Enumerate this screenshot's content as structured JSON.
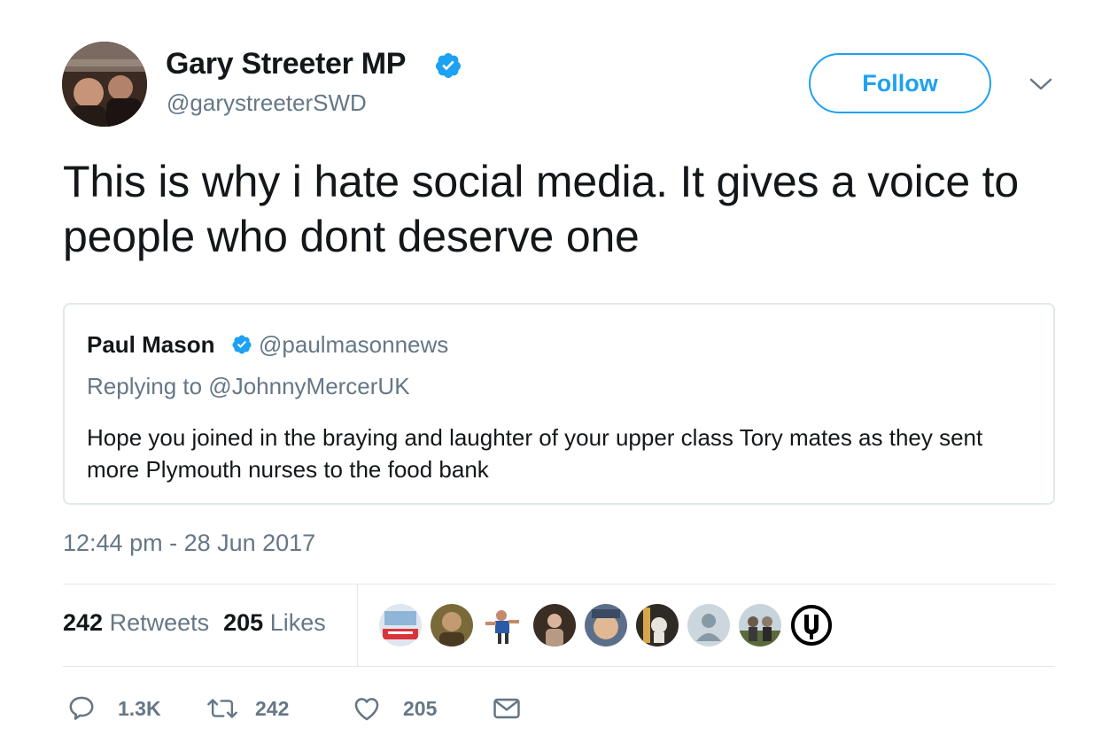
{
  "author": {
    "name": "Gary Streeter MP",
    "handle": "@garystreeterSWD",
    "verified": true
  },
  "follow_button": {
    "label": "Follow"
  },
  "tweet": {
    "text": "This is why i hate social media. It gives a voice to people who dont deserve one"
  },
  "quoted_tweet": {
    "name": "Paul Mason",
    "handle": "@paulmasonnews",
    "replying_to": "Replying to @JohnnyMercerUK",
    "text": "Hope you joined in the braying and laughter of your upper class Tory mates as they sent more Plymouth nurses to the food bank",
    "verified": true
  },
  "timestamp": "12:44 pm - 28 Jun 2017",
  "stats": {
    "retweets_count": "242",
    "retweets_label": "Retweets",
    "likes_count": "205",
    "likes_label": "Likes"
  },
  "actions": {
    "reply_count": "1.3K",
    "retweet_count": "242",
    "like_count": "205"
  },
  "colors": {
    "accent": "#1da1f2",
    "secondary_text": "#657786",
    "primary_text": "#14171a",
    "border": "#e1e8ed"
  },
  "icons": [
    "verified-badge-icon",
    "chevron-down-icon",
    "reply-icon",
    "retweet-icon",
    "like-icon",
    "message-icon"
  ]
}
